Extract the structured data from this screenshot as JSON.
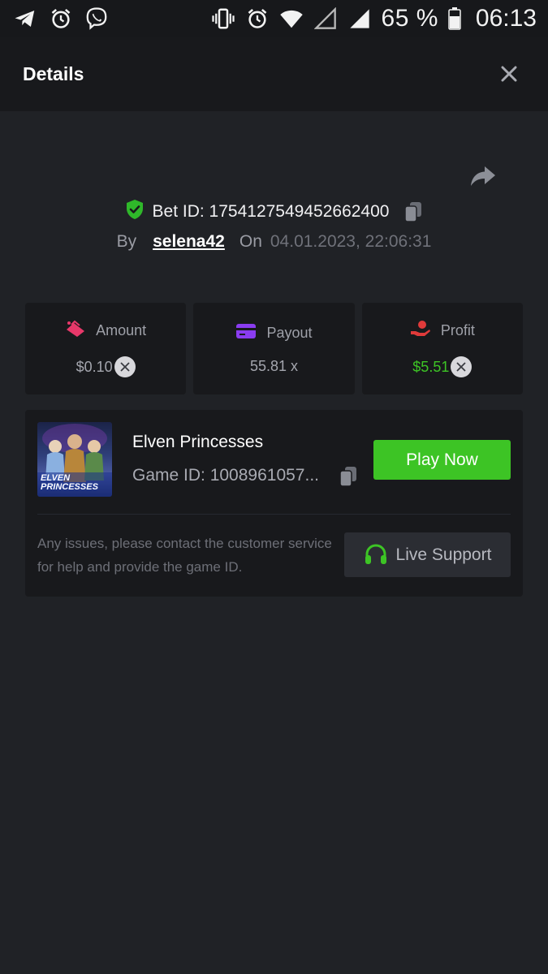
{
  "status_bar": {
    "battery": "65 %",
    "time": "06:13",
    "icons": [
      "telegram-icon",
      "alarm-icon",
      "viber-icon",
      "vibrate-icon",
      "alarm-icon",
      "wifi-icon",
      "signal-empty-icon",
      "signal-icon",
      "battery-icon"
    ]
  },
  "header": {
    "title": "Details"
  },
  "bet": {
    "id_text": "Bet ID: 1754127549452662400",
    "by_label": "By",
    "user": "selena42",
    "on_label": "On",
    "date": "04.01.2023, 22:06:31"
  },
  "stats": [
    {
      "label": "Amount",
      "value": "$0.10",
      "icon": "amount-icon"
    },
    {
      "label": "Payout",
      "value": "55.81 x",
      "icon": "payout-card-icon"
    },
    {
      "label": "Profit",
      "value": "$5.51",
      "icon": "profit-hand-icon"
    }
  ],
  "game": {
    "name": "Elven Princesses",
    "id_text": "Game ID: 1008961057...",
    "thumb_line1": "ELVEN",
    "thumb_line2": "PRINCESSES",
    "play_label": "Play Now"
  },
  "support": {
    "note": "Any issues, please contact the customer service for help and provide the game ID.",
    "button_label": "Live Support"
  },
  "colors": {
    "accent_green": "#3dc425",
    "background": "#202226",
    "panel": "#18191c",
    "amount_icon": "#e8386a",
    "payout_icon": "#8a3cf0",
    "profit_icon": "#e03a3a"
  }
}
